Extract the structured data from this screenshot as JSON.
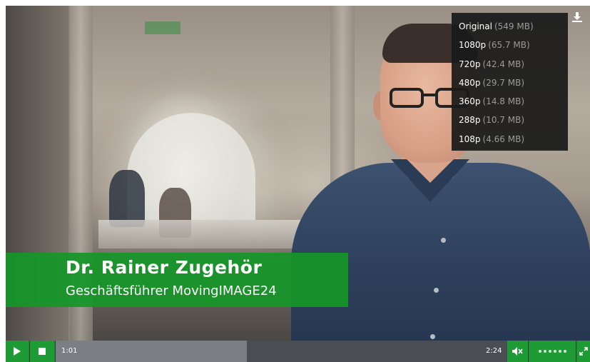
{
  "video": {
    "lower_third": {
      "name": "Dr. Rainer Zugehör",
      "role": "Geschäftsführer MovingIMAGE24"
    }
  },
  "download_menu": {
    "icon": "download-icon",
    "items": [
      {
        "label": "Original",
        "size": "(549 MB)"
      },
      {
        "label": "1080p",
        "size": "(65.7 MB)"
      },
      {
        "label": "720p",
        "size": "(42.4 MB)"
      },
      {
        "label": "480p",
        "size": "(29.7 MB)"
      },
      {
        "label": "360p",
        "size": "(14.8 MB)"
      },
      {
        "label": "288p",
        "size": "(10.7 MB)"
      },
      {
        "label": "108p",
        "size": "(4.66 MB)"
      }
    ]
  },
  "controls": {
    "current_time": "1:01",
    "total_time": "2:24",
    "progress_fraction": 0.424,
    "volume_steps": 6,
    "icons": [
      "play-icon",
      "stop-icon",
      "mute-icon",
      "fullscreen-icon"
    ]
  },
  "colors": {
    "accent_green": "#1e9b34",
    "menu_bg": "#1a1a1a"
  }
}
